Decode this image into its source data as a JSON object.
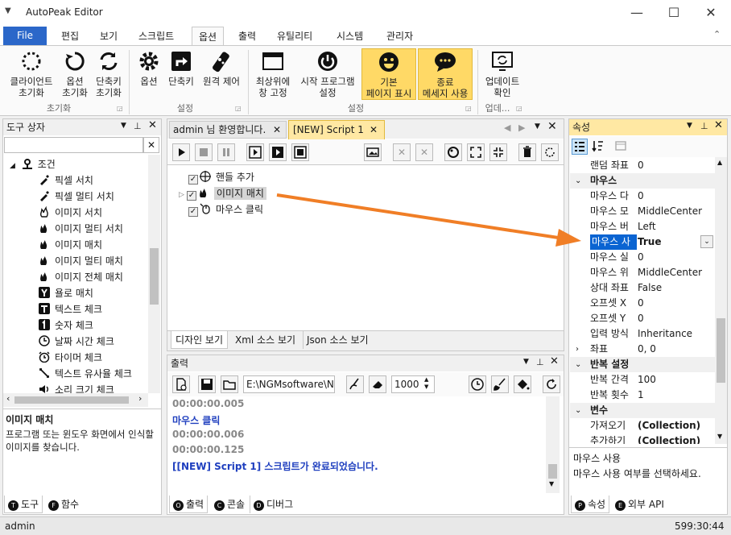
{
  "window": {
    "title": "AutoPeak Editor"
  },
  "ribbon_tabs": [
    "File",
    "편집",
    "보기",
    "스크립트",
    "옵션",
    "출력",
    "유틸리티",
    "시스템",
    "관리자"
  ],
  "ribbon": {
    "init": {
      "client_reset": [
        "클라이언트",
        "초기화"
      ],
      "option_reset": [
        "옵션",
        "초기화"
      ],
      "shortcut_reset": [
        "단축키",
        "초기화"
      ],
      "group": "초기화"
    },
    "settings": {
      "option": "옵션",
      "shortcut": "단축키",
      "remote": "원격 제어",
      "group": "설정"
    },
    "settings2": {
      "topmost": [
        "최상위에",
        "창 고정"
      ],
      "startup": [
        "시작 프로그램",
        "설정"
      ],
      "basic_page": [
        "기본",
        "페이지 표시"
      ],
      "exit_msg": [
        "종료",
        "메세지 사용"
      ],
      "group": "설정"
    },
    "update": {
      "check": [
        "업데이트",
        "확인"
      ],
      "group": "업데..."
    }
  },
  "toolbox": {
    "title": "도구 상자",
    "category": "조건",
    "items": [
      "픽셀 서치",
      "픽셀 멀티 서치",
      "이미지 서치",
      "이미지 멀티 서치",
      "이미지 매치",
      "이미지 멀티 매치",
      "이미지 전체 매치",
      "욜로 매치",
      "텍스트 체크",
      "숫자 체크",
      "날짜 시간 체크",
      "타이머 체크",
      "텍스트 유사율 체크",
      "소리 크기 체크"
    ],
    "desc_title": "이미지 매치",
    "desc_text": "프로그램 또는 윈도우 화면에서 인식할 이미지를 찾습니다.",
    "tabs": {
      "tool": "도구",
      "func": "함수"
    }
  },
  "doc_tabs": {
    "welcome": "admin 님 환영합니다.",
    "script": "[NEW] Script 1"
  },
  "script_tree": [
    "핸들 추가",
    "이미지 매치",
    "마우스 클릭"
  ],
  "view_tabs": [
    "디자인 보기",
    "Xml 소스 보기",
    "Json 소스 보기"
  ],
  "output": {
    "title": "출력",
    "path": "E:\\NGMsoftware\\NG",
    "count": "1000",
    "lines": [
      {
        "text": "00:00:00.005",
        "color": "#888888"
      },
      {
        "text": "마우스 클릭",
        "color": "#1f3fbf"
      },
      {
        "text": "00:00:00.006",
        "color": "#888888"
      },
      {
        "text": "00:00:00.125",
        "color": "#888888"
      },
      {
        "text": "[[NEW] Script 1] 스크립트가 완료되었습니다.",
        "color": "#1f3fbf"
      }
    ],
    "tabs": {
      "output": "출력",
      "console": "콘솔",
      "debug": "디버그"
    }
  },
  "properties": {
    "title": "속성",
    "rows_top": {
      "k": "랜덤 좌표",
      "v": "0"
    },
    "cat_mouse": "마우스",
    "mouse_rows": [
      {
        "k": "마우스 다",
        "v": "0"
      },
      {
        "k": "마우스 모",
        "v": "MiddleCenter"
      },
      {
        "k": "마우스 버",
        "v": "Left"
      },
      {
        "k": "마우스 사",
        "v": "True"
      },
      {
        "k": "마우스 실",
        "v": "0"
      },
      {
        "k": "마우스 위",
        "v": "MiddleCenter"
      },
      {
        "k": "상대 좌표",
        "v": "False"
      },
      {
        "k": "오프셋 X",
        "v": "0"
      },
      {
        "k": "오프셋 Y",
        "v": "0"
      },
      {
        "k": "입력 방식",
        "v": "Inheritance"
      },
      {
        "k": "좌표",
        "v": "0, 0"
      }
    ],
    "cat_repeat": "반복 설정",
    "repeat_rows": [
      {
        "k": "반복 간격",
        "v": "100"
      },
      {
        "k": "반복 횟수",
        "v": "1"
      }
    ],
    "cat_var": "변수",
    "var_rows": [
      {
        "k": "가져오기",
        "v": "(Collection)"
      },
      {
        "k": "추가하기",
        "v": "(Collection)"
      }
    ],
    "desc_title": "마우스 사용",
    "desc_text": "마우스 사용 여부를 선택하세요.",
    "tabs": {
      "prop": "속성",
      "api": "외부 API"
    }
  },
  "status": {
    "user": "admin",
    "time": "599:30:44"
  },
  "colors": {
    "accent": "#2b67c9",
    "highlight": "#ffd966",
    "arrow": "#f07e26"
  }
}
